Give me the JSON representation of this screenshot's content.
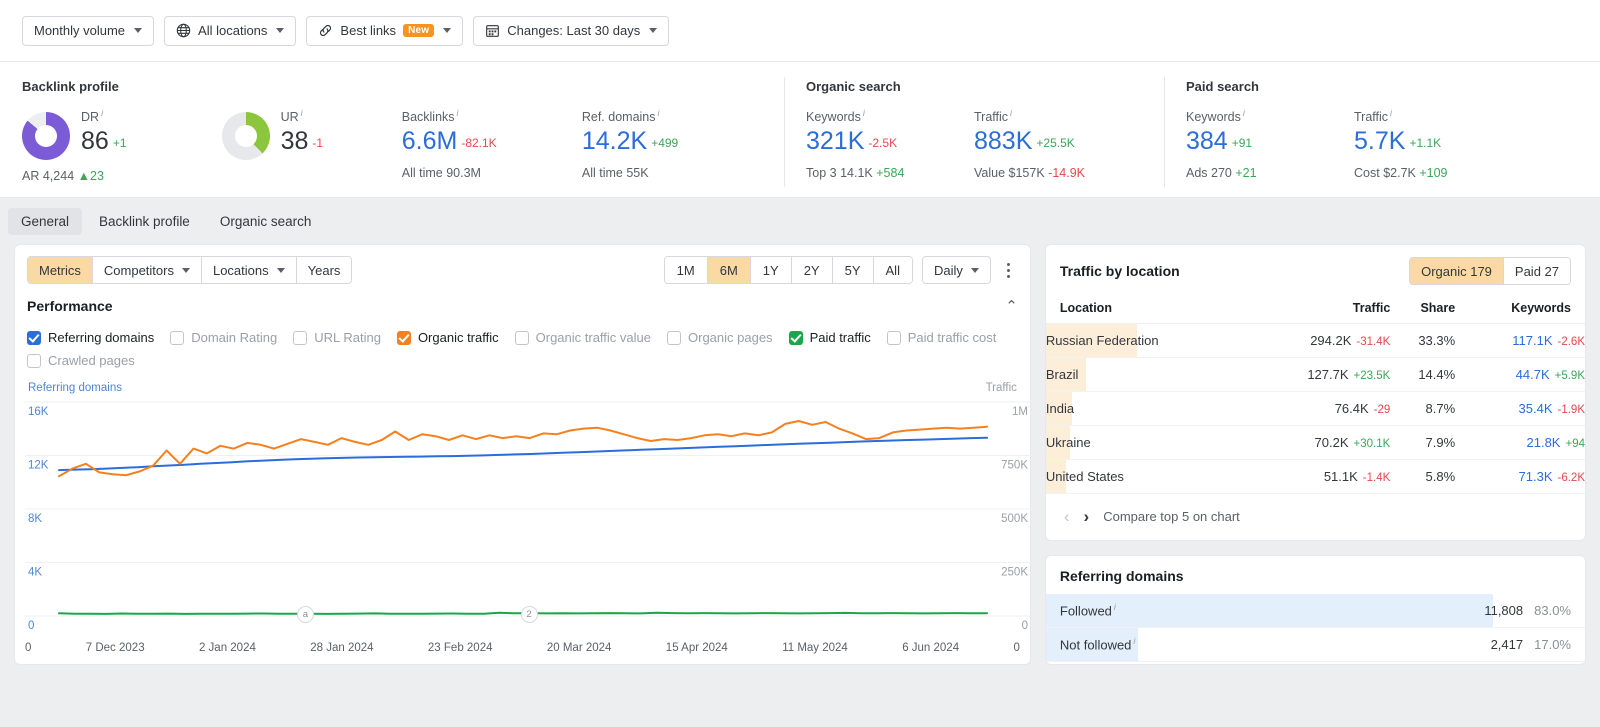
{
  "toolbar": {
    "filters": [
      {
        "id": "monthly-volume",
        "label": "Monthly volume",
        "icon": "",
        "caret": true,
        "badge": ""
      },
      {
        "id": "all-locations",
        "label": "All locations",
        "icon": "globe-icon",
        "caret": true,
        "badge": ""
      },
      {
        "id": "best-links",
        "label": "Best links",
        "icon": "link-icon",
        "caret": true,
        "badge": "New"
      },
      {
        "id": "changes",
        "label": "Changes: Last 30 days",
        "icon": "calendar-icon",
        "caret": true,
        "badge": ""
      }
    ]
  },
  "metrics": {
    "backlink_profile": {
      "title": "Backlink profile",
      "dr": {
        "label": "DR",
        "value": "86",
        "delta": "+1",
        "delta_dir": "up",
        "ring_color": "#7b5cd6",
        "ring_pct": 86
      },
      "ur": {
        "label": "UR",
        "value": "38",
        "delta": "-1",
        "delta_dir": "down",
        "ring_color": "#8cc63f",
        "ring_pct": 38
      },
      "ar": {
        "label": "AR",
        "value": "4,244",
        "delta": "▲23",
        "delta_dir": "up"
      },
      "backlinks": {
        "label": "Backlinks",
        "value": "6.6M",
        "delta": "-82.1K",
        "delta_dir": "down",
        "sub_label": "All time",
        "sub_value": "90.3M"
      },
      "ref_domains": {
        "label": "Ref. domains",
        "value": "14.2K",
        "delta": "+499",
        "delta_dir": "up",
        "sub_label": "All time",
        "sub_value": "55K"
      }
    },
    "organic_search": {
      "title": "Organic search",
      "keywords": {
        "label": "Keywords",
        "value": "321K",
        "delta": "-2.5K",
        "delta_dir": "down",
        "sub_label": "Top 3",
        "sub_value": "14.1K",
        "sub_delta": "+584",
        "sub_delta_dir": "up"
      },
      "traffic": {
        "label": "Traffic",
        "value": "883K",
        "delta": "+25.5K",
        "delta_dir": "up",
        "sub_label": "Value",
        "sub_value": "$157K",
        "sub_delta": "-14.9K",
        "sub_delta_dir": "down"
      }
    },
    "paid_search": {
      "title": "Paid search",
      "keywords": {
        "label": "Keywords",
        "value": "384",
        "delta": "+91",
        "delta_dir": "up",
        "sub_label": "Ads",
        "sub_value": "270",
        "sub_delta": "+21",
        "sub_delta_dir": "up"
      },
      "traffic": {
        "label": "Traffic",
        "value": "5.7K",
        "delta": "+1.1K",
        "delta_dir": "up",
        "sub_label": "Cost",
        "sub_value": "$2.7K",
        "sub_delta": "+109",
        "sub_delta_dir": "up"
      }
    }
  },
  "section_tabs": [
    {
      "label": "General",
      "active": true
    },
    {
      "label": "Backlink profile",
      "active": false
    },
    {
      "label": "Organic search",
      "active": false
    }
  ],
  "chart_panel": {
    "view_tabs": [
      {
        "label": "Metrics",
        "caret": false,
        "active": true
      },
      {
        "label": "Competitors",
        "caret": true,
        "active": false
      },
      {
        "label": "Locations",
        "caret": true,
        "active": false
      },
      {
        "label": "Years",
        "caret": false,
        "active": false
      }
    ],
    "ranges": [
      {
        "label": "1M",
        "active": false
      },
      {
        "label": "6M",
        "active": true
      },
      {
        "label": "1Y",
        "active": false
      },
      {
        "label": "2Y",
        "active": false
      },
      {
        "label": "5Y",
        "active": false
      },
      {
        "label": "All",
        "active": false
      }
    ],
    "granularity": {
      "label": "Daily"
    },
    "more_menu": "kebab-icon",
    "title": "Performance",
    "collapse_icon": "chevron-up-icon",
    "checkboxes": [
      {
        "label": "Referring domains",
        "checked": true,
        "color": "#2a6ddb"
      },
      {
        "label": "Domain Rating",
        "checked": false,
        "color": ""
      },
      {
        "label": "URL Rating",
        "checked": false,
        "color": ""
      },
      {
        "label": "Organic traffic",
        "checked": true,
        "color": "#f7801e"
      },
      {
        "label": "Organic traffic value",
        "checked": false,
        "color": ""
      },
      {
        "label": "Organic pages",
        "checked": false,
        "color": ""
      },
      {
        "label": "Paid traffic",
        "checked": true,
        "color": "#1aa64b"
      },
      {
        "label": "Paid traffic cost",
        "checked": false,
        "color": ""
      },
      {
        "label": "Crawled pages",
        "checked": false,
        "color": ""
      }
    ],
    "annotations": [
      {
        "label": "a",
        "x_pct": 26.5
      },
      {
        "label": "2",
        "x_pct": 50.6
      }
    ]
  },
  "chart_data": {
    "type": "line",
    "title": "Performance",
    "left_axis_label": "Referring domains",
    "right_axis_label": "Traffic",
    "left_ticks": [
      "16K",
      "12K",
      "8K",
      "4K",
      "0"
    ],
    "right_ticks": [
      "1M",
      "750K",
      "500K",
      "250K",
      "0"
    ],
    "left_ylim": [
      0,
      18000
    ],
    "right_ylim": [
      0,
      1125000
    ],
    "grid": true,
    "legend": "checkbox-row",
    "xlabel": "",
    "ylabel": "",
    "x": [
      "7 Dec 2023",
      "2 Jan 2024",
      "28 Jan 2024",
      "23 Feb 2024",
      "20 Mar 2024",
      "15 Apr 2024",
      "11 May 2024",
      "6 Jun 2024"
    ],
    "series": [
      {
        "name": "Referring domains",
        "color": "#2a6ddb",
        "axis": "left",
        "values": [
          12270,
          12310,
          12350,
          12400,
          12460,
          12520,
          12590,
          12660,
          12730,
          12800,
          12870,
          12940,
          13010,
          13070,
          13130,
          13180,
          13230,
          13270,
          13300,
          13330,
          13350,
          13370,
          13390,
          13410,
          13430,
          13450,
          13480,
          13510,
          13550,
          13590,
          13630,
          13680,
          13730,
          13780,
          13830,
          13880,
          13930,
          13980,
          14030,
          14080,
          14130,
          14180,
          14230,
          14280,
          14330,
          14380,
          14430,
          14480,
          14530,
          14580,
          14630,
          14680,
          14720,
          14760,
          14800,
          14840,
          14880,
          14920,
          14960,
          15000
        ]
      },
      {
        "name": "Organic traffic",
        "color": "#f7801e",
        "axis": "right",
        "values": [
          735000,
          775000,
          800000,
          755000,
          745000,
          740000,
          760000,
          790000,
          870000,
          800000,
          880000,
          855000,
          895000,
          880000,
          910000,
          900000,
          880000,
          905000,
          930000,
          915000,
          900000,
          935000,
          915000,
          900000,
          925000,
          970000,
          925000,
          955000,
          945000,
          925000,
          950000,
          930000,
          950000,
          935000,
          945000,
          935000,
          960000,
          955000,
          975000,
          985000,
          990000,
          975000,
          955000,
          935000,
          920000,
          930000,
          925000,
          935000,
          950000,
          955000,
          945000,
          960000,
          950000,
          965000,
          1010000,
          1025000,
          1005000,
          1020000,
          985000,
          960000,
          930000,
          935000,
          965000,
          975000,
          980000,
          985000,
          990000,
          985000,
          990000,
          995000
        ]
      },
      {
        "name": "Paid traffic",
        "color": "#1aa64b",
        "axis": "right",
        "values": [
          14000,
          12000,
          11500,
          11000,
          13000,
          12000,
          11500,
          12500,
          11000,
          11500,
          12000,
          11500,
          12500,
          13000,
          12000,
          11500,
          12000,
          11000,
          11500,
          12500,
          13500,
          12000,
          11500,
          12000,
          12500,
          13000,
          12000,
          11500,
          17000,
          14000,
          15000,
          13500,
          14500,
          13500,
          14000,
          15000,
          14000,
          13500,
          17500,
          15000,
          14000,
          15500,
          14500,
          13500,
          14000,
          15500,
          14500,
          13500,
          14000,
          15000,
          16500,
          14000,
          14500,
          15500,
          14500,
          13500,
          14000,
          15000,
          14500,
          14000
        ]
      }
    ]
  },
  "traffic_by_location": {
    "title": "Traffic by location",
    "toggle": [
      {
        "label": "Organic 179",
        "active": true
      },
      {
        "label": "Paid 27",
        "active": false
      }
    ],
    "columns": [
      "Location",
      "Traffic",
      "Share",
      "Keywords"
    ],
    "rows": [
      {
        "location": "Russian Federation",
        "traffic": "294.2K",
        "traffic_delta": "-31.4K",
        "traffic_dir": "down",
        "share": "33.3%",
        "keywords": "117.1K",
        "keywords_delta": "-2.6K",
        "keywords_dir": "down",
        "bar_pct": 46
      },
      {
        "location": "Brazil",
        "traffic": "127.7K",
        "traffic_delta": "+23.5K",
        "traffic_dir": "up",
        "share": "14.4%",
        "keywords": "44.7K",
        "keywords_delta": "+5.9K",
        "keywords_dir": "up",
        "bar_pct": 20
      },
      {
        "location": "India",
        "traffic": "76.4K",
        "traffic_delta": "-29",
        "traffic_dir": "down",
        "share": "8.7%",
        "keywords": "35.4K",
        "keywords_delta": "-1.9K",
        "keywords_dir": "down",
        "bar_pct": 13
      },
      {
        "location": "Ukraine",
        "traffic": "70.2K",
        "traffic_delta": "+30.1K",
        "traffic_dir": "up",
        "share": "7.9%",
        "keywords": "21.8K",
        "keywords_delta": "+94",
        "keywords_dir": "up",
        "bar_pct": 12
      },
      {
        "location": "United States",
        "traffic": "51.1K",
        "traffic_delta": "-1.4K",
        "traffic_dir": "down",
        "share": "5.8%",
        "keywords": "71.3K",
        "keywords_delta": "-6.2K",
        "keywords_dir": "down",
        "bar_pct": 10
      }
    ],
    "pager": {
      "prev": "‹",
      "next": "›",
      "compare_label": "Compare top 5 on chart"
    }
  },
  "referring_domains_panel": {
    "title": "Referring domains",
    "rows": [
      {
        "label": "Followed",
        "value": "11,808",
        "pct": "83.0%",
        "bar_pct": 83
      },
      {
        "label": "Not followed",
        "value": "2,417",
        "pct": "17.0%",
        "bar_pct": 17
      }
    ]
  }
}
